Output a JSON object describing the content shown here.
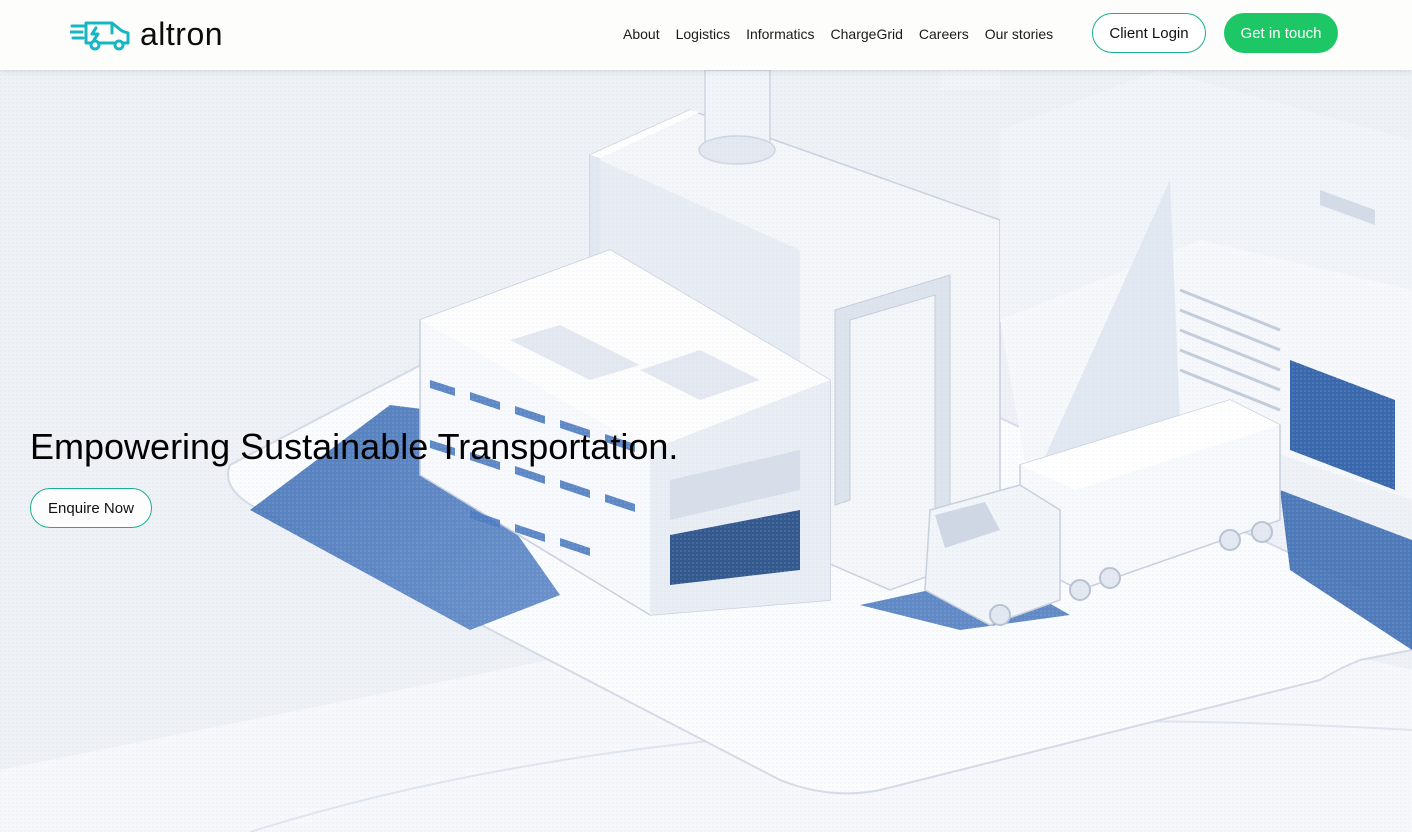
{
  "brand": {
    "name": "altron",
    "logo_icon": "electric-truck-icon",
    "accent_color": "#19b08f",
    "cta_color": "#1ec766"
  },
  "nav": {
    "items": [
      {
        "label": "About"
      },
      {
        "label": "Logistics"
      },
      {
        "label": "Informatics"
      },
      {
        "label": "ChargeGrid"
      },
      {
        "label": "Careers"
      },
      {
        "label": "Our stories"
      }
    ]
  },
  "header_actions": {
    "client_login": "Client Login",
    "get_in_touch": "Get in touch"
  },
  "hero": {
    "title": "Empowering Sustainable Transportation.",
    "cta": "Enquire Now",
    "illustration": "isometric-factory-and-truck-illustration"
  }
}
